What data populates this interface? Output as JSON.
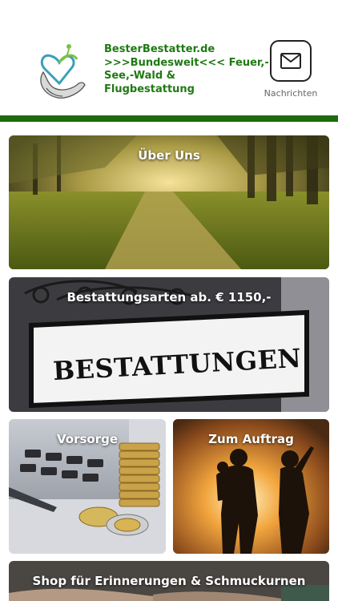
{
  "header": {
    "title_lines": [
      "BesterBestatter.de",
      ">>>Bundesweit<<< Feuer,-",
      "See,-Wald &",
      "Flugbestattung"
    ],
    "messages_label": "Nachrichten",
    "messages_icon": "envelope-icon",
    "logo_icon": "logo-heart-hands-icon"
  },
  "colors": {
    "brand_green": "#1e6b0f",
    "title_green": "#1f7a12"
  },
  "tiles": [
    {
      "label": "Über Uns",
      "image": "forest-path-image"
    },
    {
      "label": "Bestattungsarten ab. € 1150,-",
      "image": "bestattungen-sign-image",
      "sign_text": "BESTATTUNGEN"
    },
    {
      "label": "Vorsorge",
      "image": "calculator-coins-image"
    },
    {
      "label": "Zum Auftrag",
      "image": "family-silhouette-image"
    },
    {
      "label": "Shop für Erinnerungen & Schmuckurnen",
      "image": "hands-image"
    }
  ]
}
